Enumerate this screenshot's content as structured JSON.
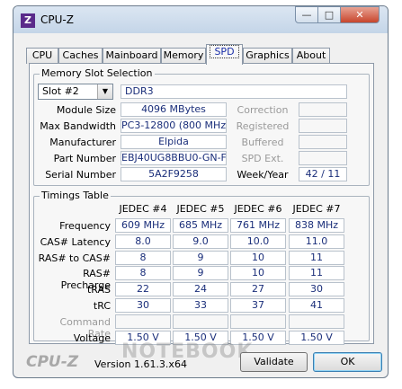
{
  "window": {
    "title": "CPU-Z",
    "app_icon": "Z"
  },
  "tabs": [
    "CPU",
    "Caches",
    "Mainboard",
    "Memory",
    "SPD",
    "Graphics",
    "About"
  ],
  "memory_slot": {
    "legend": "Memory Slot Selection",
    "slot_value": "Slot #2",
    "type": "DDR3",
    "labels": {
      "module_size": "Module Size",
      "max_bandwidth": "Max Bandwidth",
      "manufacturer": "Manufacturer",
      "part_number": "Part Number",
      "serial_number": "Serial Number",
      "correction": "Correction",
      "registered": "Registered",
      "buffered": "Buffered",
      "spd_ext": "SPD Ext.",
      "week_year": "Week/Year"
    },
    "values": {
      "module_size": "4096 MBytes",
      "max_bandwidth": "PC3-12800 (800 MHz)",
      "manufacturer": "Elpida",
      "part_number": "EBJ40UG8BBU0-GN-F",
      "serial_number": "5A2F9258",
      "week_year": "42 / 11"
    }
  },
  "timings": {
    "legend": "Timings Table",
    "columns": [
      "JEDEC #4",
      "JEDEC #5",
      "JEDEC #6",
      "JEDEC #7"
    ],
    "rows": [
      {
        "label": "Frequency",
        "values": [
          "609 MHz",
          "685 MHz",
          "761 MHz",
          "838 MHz"
        ]
      },
      {
        "label": "CAS# Latency",
        "values": [
          "8.0",
          "9.0",
          "10.0",
          "11.0"
        ]
      },
      {
        "label": "RAS# to CAS#",
        "values": [
          "8",
          "9",
          "10",
          "11"
        ]
      },
      {
        "label": "RAS# Precharge",
        "values": [
          "8",
          "9",
          "10",
          "11"
        ]
      },
      {
        "label": "tRAS",
        "values": [
          "22",
          "24",
          "27",
          "30"
        ]
      },
      {
        "label": "tRC",
        "values": [
          "30",
          "33",
          "37",
          "41"
        ]
      },
      {
        "label": "Command Rate",
        "values": [
          "",
          "",
          "",
          ""
        ],
        "gray": true
      },
      {
        "label": "Voltage",
        "values": [
          "1.50 V",
          "1.50 V",
          "1.50 V",
          "1.50 V"
        ]
      }
    ]
  },
  "footer": {
    "logo": "CPU-Z",
    "version": "Version 1.61.3.x64",
    "validate": "Validate",
    "ok": "OK",
    "watermark": "NOTEBOOK"
  }
}
